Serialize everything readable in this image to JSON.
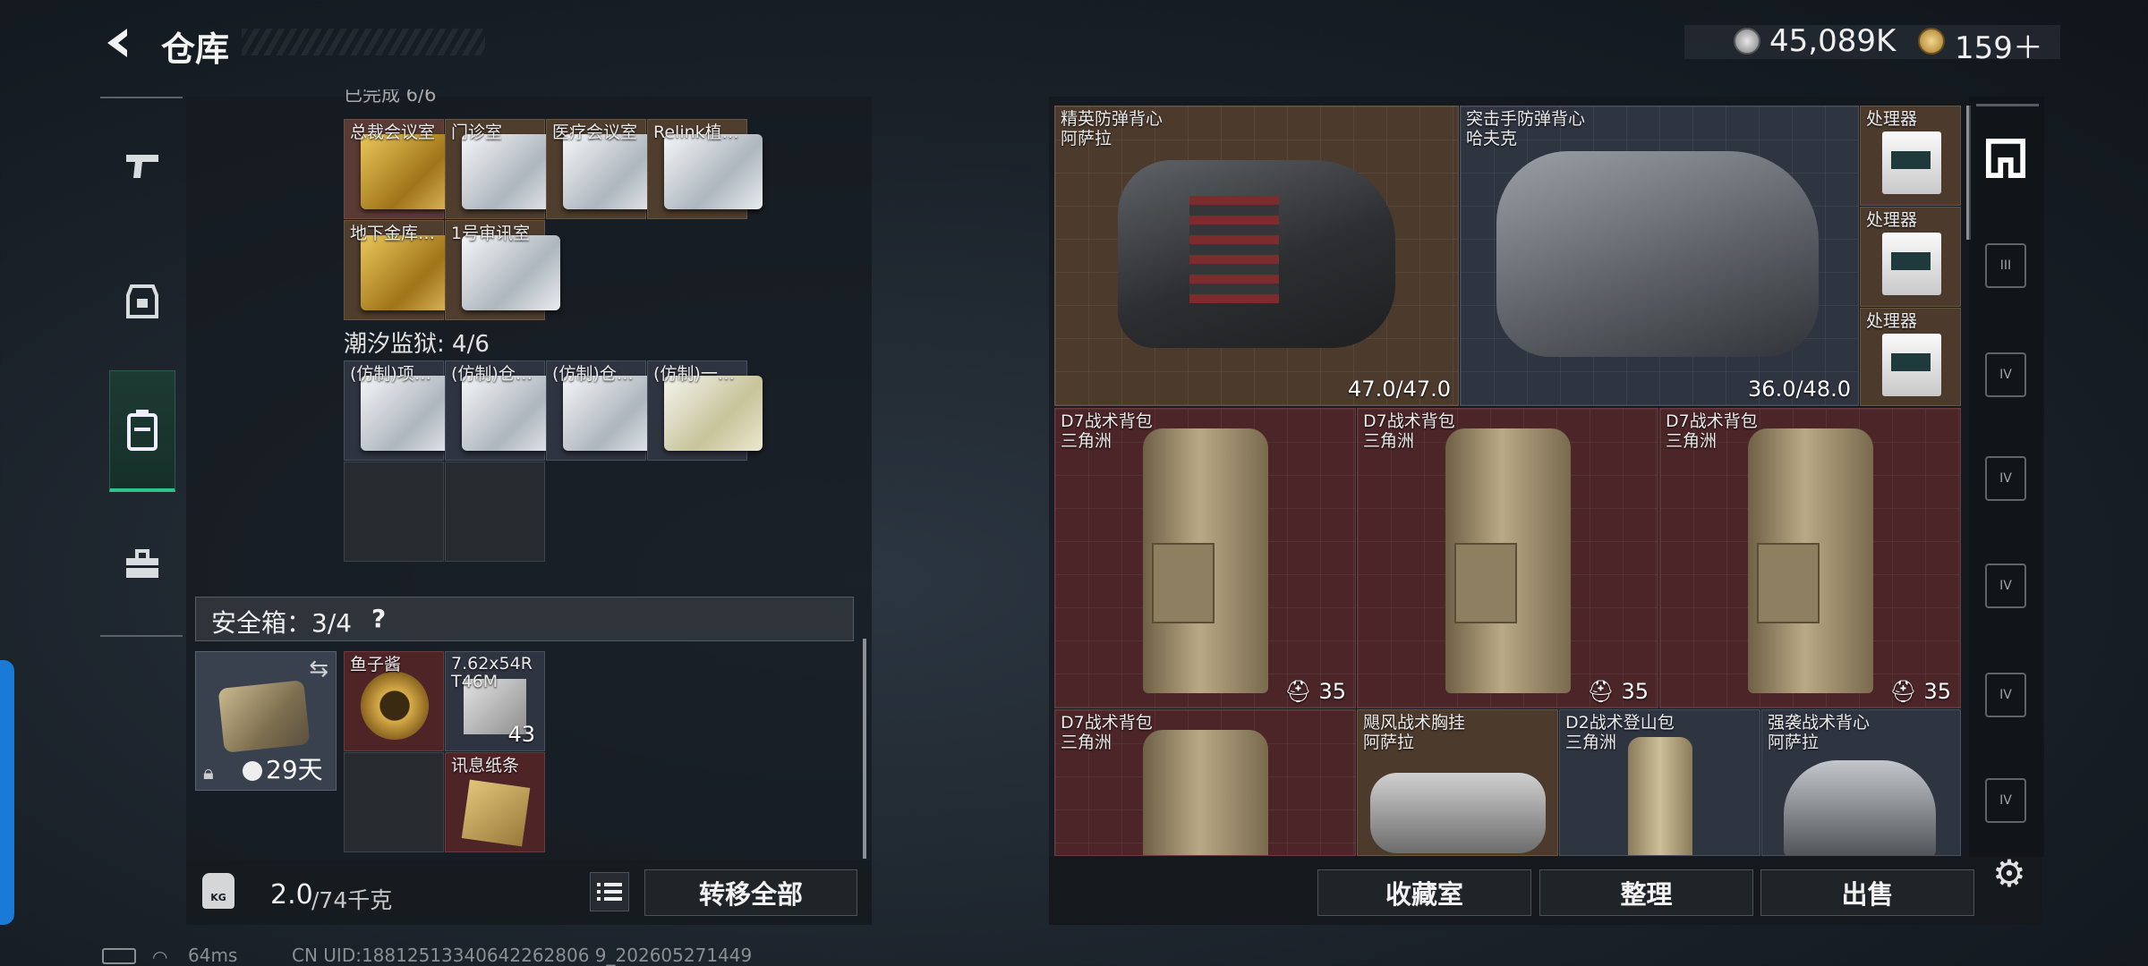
{
  "header": {
    "title": "仓库",
    "currency1": "45,089K",
    "currency2": "159＋"
  },
  "left_sections": {
    "partial_label": "已完成 6/6",
    "group1": [
      "总裁会议室",
      "门诊室",
      "医疗会议室",
      "Relink植…",
      "地下金库…",
      "1号审讯室"
    ],
    "group2_title": "潮汐监狱: 4/6",
    "group2": [
      "(仿制)项…",
      "(仿制)仓…",
      "(仿制)仓…",
      "(仿制)一…"
    ]
  },
  "safe_box": {
    "label": "安全箱：3/4",
    "help": "?",
    "days": "29天",
    "items": [
      {
        "name": "鱼子酱"
      },
      {
        "name": "7.62x54R T46M",
        "count": "43"
      },
      {
        "name": "讯息纸条"
      }
    ]
  },
  "weight": {
    "current": "2.0",
    "max": "/74千克"
  },
  "buttons": {
    "transfer_all": "转移全部",
    "collection_room": "收藏室",
    "organize": "整理",
    "sell": "出售"
  },
  "stash": {
    "vest1": {
      "name": "精英防弹背心",
      "maker": "阿萨拉",
      "durability": "47.0/47.0"
    },
    "vest2": {
      "name": "突击手防弹背心",
      "maker": "哈夫克",
      "durability": "36.0/48.0"
    },
    "processors": [
      "处理器",
      "处理器",
      "处理器"
    ],
    "bags": [
      {
        "name": "D7战术背包",
        "maker": "三角洲",
        "cap": "35"
      },
      {
        "name": "D7战术背包",
        "maker": "三角洲",
        "cap": "35"
      },
      {
        "name": "D7战术背包",
        "maker": "三角洲",
        "cap": "35"
      }
    ],
    "row3": [
      {
        "name": "D7战术背包",
        "maker": "三角洲"
      },
      {
        "name": "飓风战术胸挂",
        "maker": "阿萨拉"
      },
      {
        "name": "D2战术登山包",
        "maker": "三角洲"
      },
      {
        "name": "强袭战术背心",
        "maker": "阿萨拉"
      }
    ]
  },
  "ribbon": [
    "III",
    "IV",
    "IV",
    "IV",
    "IV",
    "IV"
  ],
  "status": {
    "ping": "64ms",
    "uid": "CN UID:18812513340642262806 9_202605271449"
  },
  "colors": {
    "accent": "#2ec48a",
    "blue": "#1a7ad8"
  }
}
